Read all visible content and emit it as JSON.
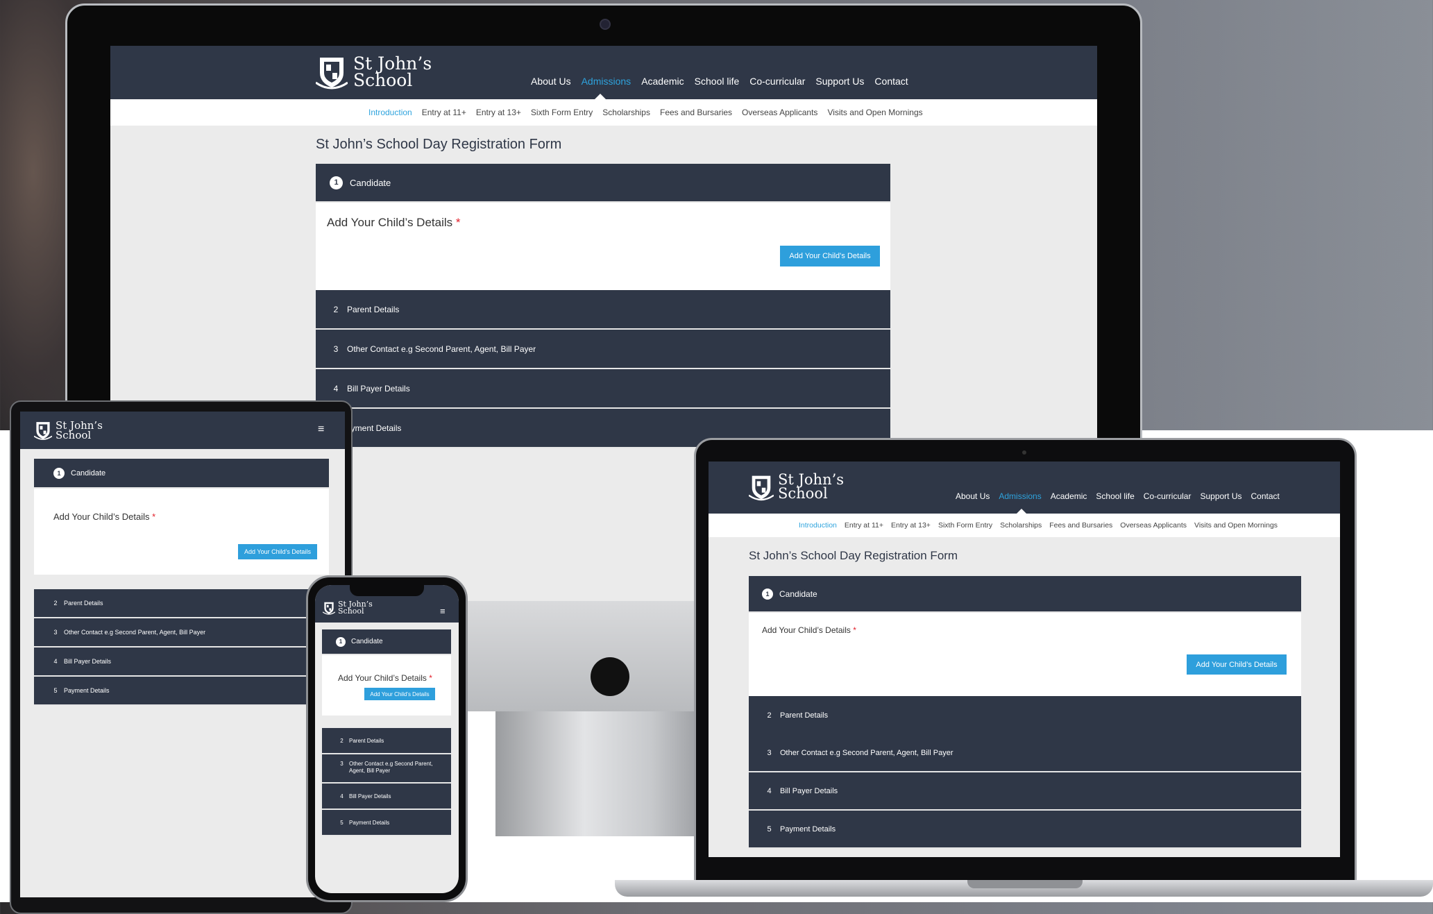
{
  "site": {
    "logo_line1": "St John’s",
    "logo_line2": "School",
    "nav": [
      "About Us",
      "Admissions",
      "Academic",
      "School life",
      "Co-curricular",
      "Support Us",
      "Contact"
    ],
    "active_nav": "Admissions",
    "subnav": [
      "Introduction",
      "Entry at 11+",
      "Entry at 13+",
      "Sixth Form Entry",
      "Scholarships",
      "Fees and Bursaries",
      "Overseas Applicants",
      "Visits and Open Mornings"
    ],
    "active_subnav": "Introduction"
  },
  "form": {
    "title": "St John’s School Day Registration Form",
    "step1_number": "1",
    "step1_label": "Candidate",
    "panel_title": "Add Your Child’s Details",
    "required_mark": "*",
    "add_button": "Add Your Child’s Details",
    "steps": [
      {
        "number": "2",
        "label": "Parent Details"
      },
      {
        "number": "3",
        "label": "Other Contact e.g Second Parent, Agent, Bill Payer"
      },
      {
        "number": "4",
        "label": "Bill Payer Details"
      },
      {
        "number": "5",
        "label": "Payment Details"
      }
    ],
    "phone_step3_line1": "Other Contact e.g Second Parent,",
    "phone_step3_line2": "Agent, Bill Payer",
    "monitor_partial_step5": "ayment Details"
  },
  "icons": {
    "logo": "school-crest-icon",
    "menu": "hamburger-menu-icon",
    "apple": "apple-logo-icon",
    "camera": "camera-icon"
  },
  "colors": {
    "header": "#2f3747",
    "accent": "#2ea3dd",
    "button": "#2e9fdc",
    "required": "#e2202b",
    "page_bg": "#ebebeb"
  }
}
